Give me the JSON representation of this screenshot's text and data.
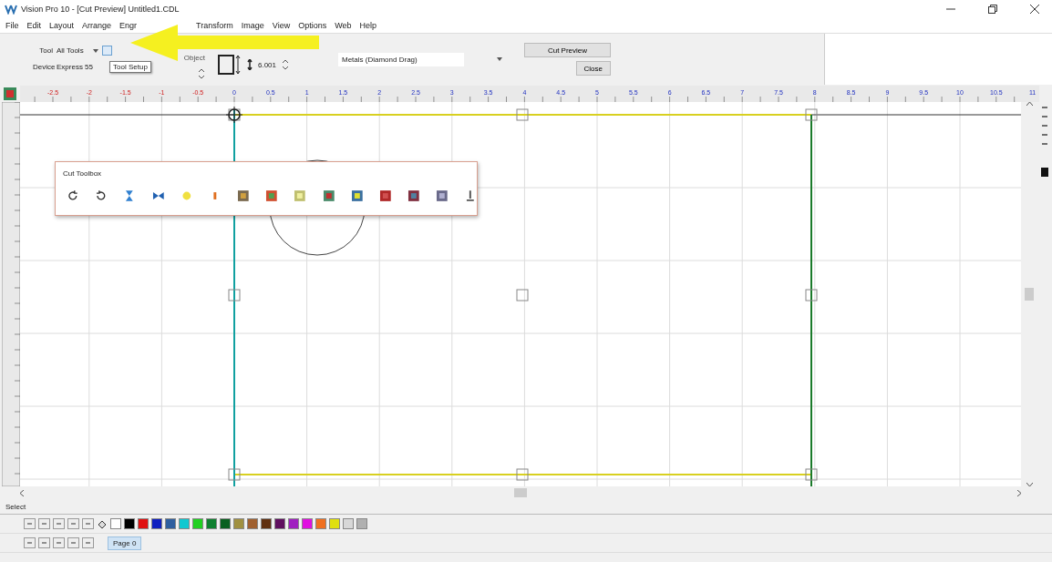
{
  "window": {
    "title": "Vision Pro 10 - [Cut Preview] Untitled1.CDL"
  },
  "menu": [
    "File",
    "Edit",
    "Layout",
    "Arrange",
    "Engr",
    "Transform",
    "Image",
    "View",
    "Options",
    "Web",
    "Help"
  ],
  "toolbar": {
    "tool_label": "Tool",
    "tool_value": "All Tools",
    "device_label": "Device",
    "device_value": "Express 55",
    "tooltip": "Tool Setup",
    "object_label": "Object",
    "height_value": "6.001",
    "material": "Metals (Diamond Drag)",
    "buttons": [
      "Cut Preview",
      "Close"
    ]
  },
  "ruler": {
    "labels": [
      "-2.5",
      "-2",
      "-1.5",
      "-1",
      "-0.5",
      "0",
      "0.5",
      "1",
      "1.5",
      "2",
      "2.5",
      "3",
      "3.5",
      "4",
      "4.5",
      "5",
      "5.5",
      "6",
      "6.5",
      "7",
      "7.5",
      "8",
      "8.5",
      "9",
      "9.5",
      "10",
      "10.5",
      "11"
    ]
  },
  "toolbox": {
    "title": "Cut Toolbox"
  },
  "status_bar": {
    "text": "Select"
  },
  "palette": [
    {
      "color": "#ffffff"
    },
    {
      "color": "#000000"
    },
    {
      "color": "#e01010"
    },
    {
      "color": "#1020c0"
    },
    {
      "color": "#2f5f9f"
    },
    {
      "color": "#10c8d0"
    },
    {
      "color": "#20d020"
    },
    {
      "color": "#108030"
    },
    {
      "color": "#0a6020"
    },
    {
      "color": "#a09040"
    },
    {
      "color": "#a06030"
    },
    {
      "color": "#603010"
    },
    {
      "color": "#601060"
    },
    {
      "color": "#a020c0"
    },
    {
      "color": "#e010e0"
    },
    {
      "color": "#f07020"
    },
    {
      "color": "#e0e010"
    },
    {
      "color": "#d8d8d8"
    },
    {
      "color": "#b0b0b0"
    }
  ],
  "pages": [
    {
      "label": "Page 0",
      "selected": true
    }
  ]
}
